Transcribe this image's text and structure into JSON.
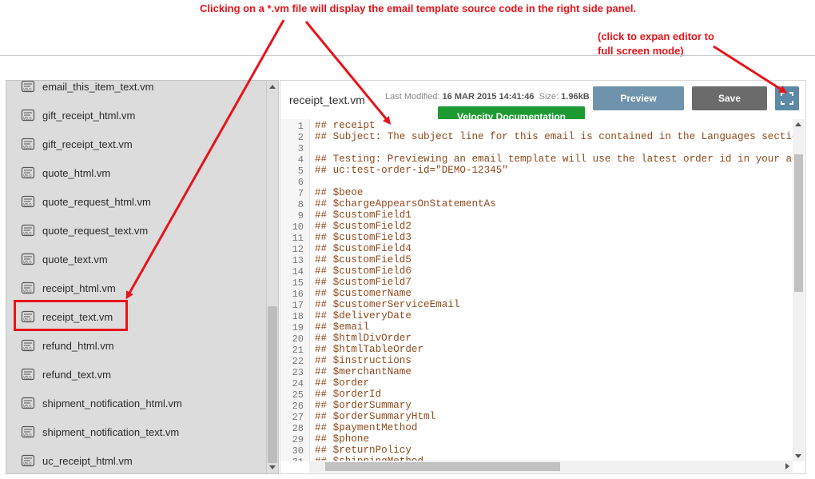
{
  "annotations": {
    "top": "Clicking on a *.vm file will display the email template source code in the right side panel.",
    "right_line1": "(click to expan editor to",
    "right_line2": "full screen mode)"
  },
  "file_list": [
    "email_this_item_text.vm",
    "gift_receipt_html.vm",
    "gift_receipt_text.vm",
    "quote_html.vm",
    "quote_request_html.vm",
    "quote_request_text.vm",
    "quote_text.vm",
    "receipt_html.vm",
    "receipt_text.vm",
    "refund_html.vm",
    "refund_text.vm",
    "shipment_notification_html.vm",
    "shipment_notification_text.vm",
    "uc_receipt_html.vm"
  ],
  "selected_file": "receipt_text.vm",
  "editor": {
    "file_name": "receipt_text.vm",
    "last_modified_label": "Last Modified:",
    "last_modified_value": "16 MAR 2015 14:41:46",
    "size_label": "Size:",
    "size_value": "1.96kB",
    "preview_label": "Preview",
    "save_label": "Save",
    "velocity_label": "Velocity Documentation"
  },
  "code_lines": [
    "## receipt",
    "## Subject: The subject line for this email is contained in the Languages section",
    "",
    "## Testing: Previewing an email template will use the latest order id in your account",
    "## uc:test-order-id=\"DEMO-12345\"",
    "",
    "## $beoe",
    "## $chargeAppearsOnStatementAs",
    "## $customField1",
    "## $customField2",
    "## $customField3",
    "## $customField4",
    "## $customField5",
    "## $customField6",
    "## $customField7",
    "## $customerName",
    "## $customerServiceEmail",
    "## $deliveryDate",
    "## $email",
    "## $htmlDivOrder",
    "## $htmlTableOrder",
    "## $instructions",
    "## $merchantName",
    "## $order",
    "## $orderId",
    "## $orderSummary",
    "## $orderSummaryHtml",
    "## $paymentMethod",
    "## $phone",
    "## $returnPolicy",
    "## $shippingMethod",
    ""
  ],
  "colors": {
    "annotation": "#e8141b",
    "preview": "#6f93ac",
    "save": "#6b6b6b",
    "expand": "#5b8aa6",
    "velocity": "#1e9a33",
    "code_text": "#8e4a1c"
  },
  "icons": {
    "file_icon": "velocity-file-icon",
    "expand_icon": "expand-fullscreen-icon"
  }
}
